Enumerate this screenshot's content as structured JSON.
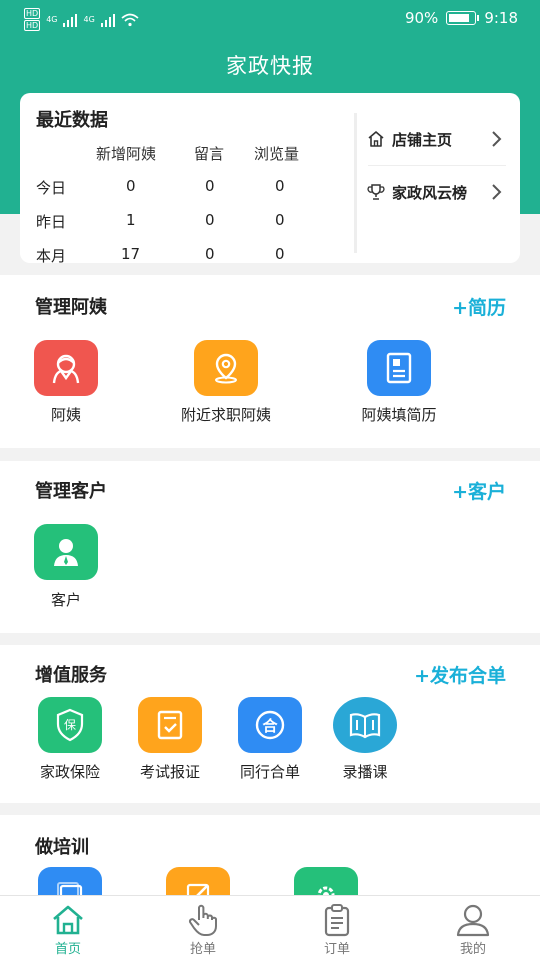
{
  "status_bar": {
    "hd_top": "HD",
    "hd_bottom": "HD",
    "net1": "4G",
    "net2": "4G",
    "battery": "90%",
    "time": "9:18"
  },
  "header": {
    "title": "家政快报"
  },
  "stats_card": {
    "title": "最近数据",
    "columns": [
      "新增阿姨",
      "留言",
      "浏览量"
    ],
    "rows": [
      {
        "label": "今日",
        "values": [
          "0",
          "0",
          "0"
        ]
      },
      {
        "label": "昨日",
        "values": [
          "1",
          "0",
          "0"
        ]
      },
      {
        "label": "本月",
        "values": [
          "17",
          "0",
          "0"
        ]
      }
    ],
    "links": [
      {
        "label": "店铺主页",
        "icon": "home-icon"
      },
      {
        "label": "家政风云榜",
        "icon": "trophy-icon"
      }
    ]
  },
  "manage_aunt": {
    "title": "管理阿姨",
    "action": "+简历",
    "items": [
      {
        "label": "阿姨",
        "icon": "aunt-icon",
        "color": "#f0564f"
      },
      {
        "label": "附近求职阿姨",
        "icon": "location-icon",
        "color": "#ffa41c"
      },
      {
        "label": "阿姨填简历",
        "icon": "resume-icon",
        "color": "#2f8cf3"
      }
    ]
  },
  "manage_customer": {
    "title": "管理客户",
    "action": "+客户",
    "items": [
      {
        "label": "客户",
        "icon": "customer-icon",
        "color": "#25c07a"
      }
    ]
  },
  "value_services": {
    "title": "增值服务",
    "action": "+发布合单",
    "items": [
      {
        "label": "家政保险",
        "icon": "insurance-icon",
        "badge": "保",
        "color": "#25c07a"
      },
      {
        "label": "考试报证",
        "icon": "exam-icon",
        "color": "#ffa41c"
      },
      {
        "label": "同行合单",
        "icon": "merge-order-icon",
        "badge": "合",
        "color": "#2f8cf3"
      },
      {
        "label": "录播课",
        "icon": "book-icon",
        "color": "#2aa7d6"
      }
    ]
  },
  "training": {
    "title": "做培训",
    "items": [
      {
        "icon": "gallery-icon",
        "color": "#2f8cf3"
      },
      {
        "icon": "edit-icon",
        "color": "#ffa41c"
      },
      {
        "icon": "gear-icon",
        "color": "#25c07a"
      }
    ]
  },
  "tabs": [
    {
      "label": "首页",
      "icon": "home-icon",
      "active": true
    },
    {
      "label": "抢单",
      "icon": "hand-pointer-icon",
      "active": false
    },
    {
      "label": "订单",
      "icon": "clipboard-icon",
      "active": false
    },
    {
      "label": "我的",
      "icon": "user-icon",
      "active": false
    }
  ],
  "colors": {
    "brand": "#21b191",
    "accent_text": "#1ab0d8"
  }
}
